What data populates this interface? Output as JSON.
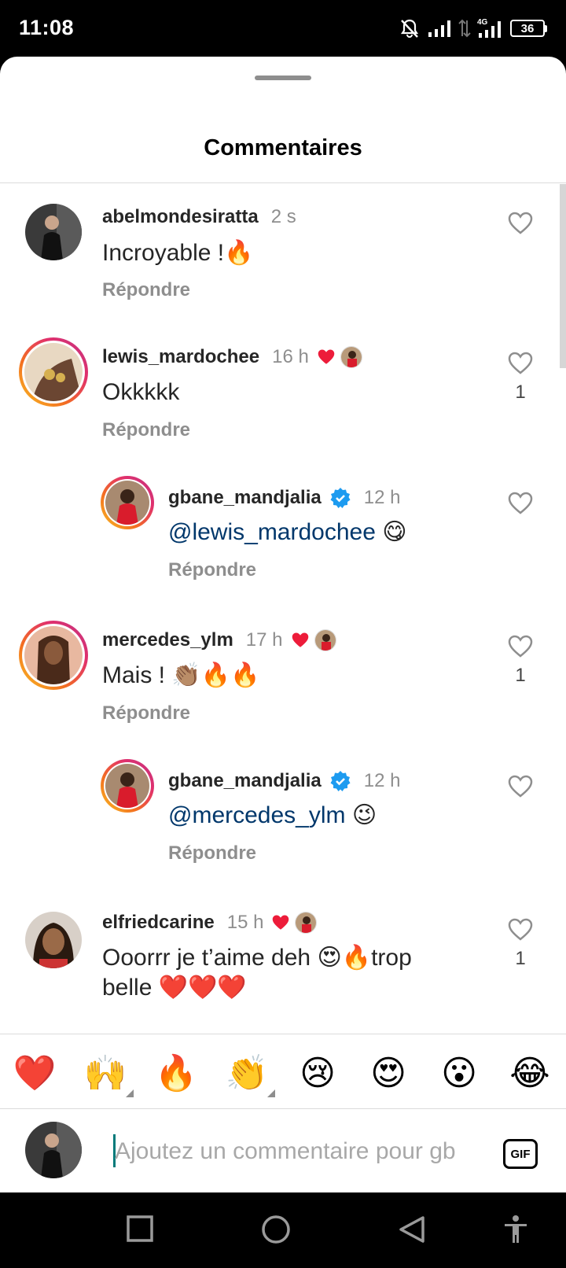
{
  "status_bar": {
    "time": "11:08",
    "network": "4G",
    "battery": "36"
  },
  "sheet": {
    "title": "Commentaires"
  },
  "comments": [
    {
      "username": "abelmondesiratta",
      "time": "2 s",
      "text": "Incroyable !🔥",
      "reply_label": "Répondre",
      "likes": ""
    },
    {
      "username": "lewis_mardochee",
      "time": "16 h",
      "text": "Okkkkk",
      "reply_label": "Répondre",
      "likes": "1"
    },
    {
      "username": "gbane_mandjalia",
      "time": "12 h",
      "mention": "@lewis_mardochee",
      "text_suffix": " 😋",
      "reply_label": "Répondre",
      "likes": ""
    },
    {
      "username": "mercedes_ylm",
      "time": "17 h",
      "text": "Mais ! 👏🏽🔥🔥",
      "reply_label": "Répondre",
      "likes": "1"
    },
    {
      "username": "gbane_mandjalia",
      "time": "12 h",
      "mention": "@mercedes_ylm",
      "text_suffix": " 😉",
      "reply_label": "Répondre",
      "likes": ""
    },
    {
      "username": "elfriedcarine",
      "time": "15 h",
      "text_line1": "Ooorrr je t’aime deh 😍🔥trop",
      "text_line2": "belle ❤️❤️❤️",
      "likes": "1"
    }
  ],
  "emoji_bar": [
    "❤️",
    "🙌",
    "🔥",
    "👏",
    "😢",
    "😍",
    "😮",
    "😂"
  ],
  "input": {
    "placeholder": "Ajoutez un commentaire pour gb",
    "gif_label": "GIF"
  },
  "colors": {
    "link": "#00376b",
    "muted": "#8e8e8e",
    "heart": "#ed1c3a",
    "verified": "#1d9bf0"
  }
}
